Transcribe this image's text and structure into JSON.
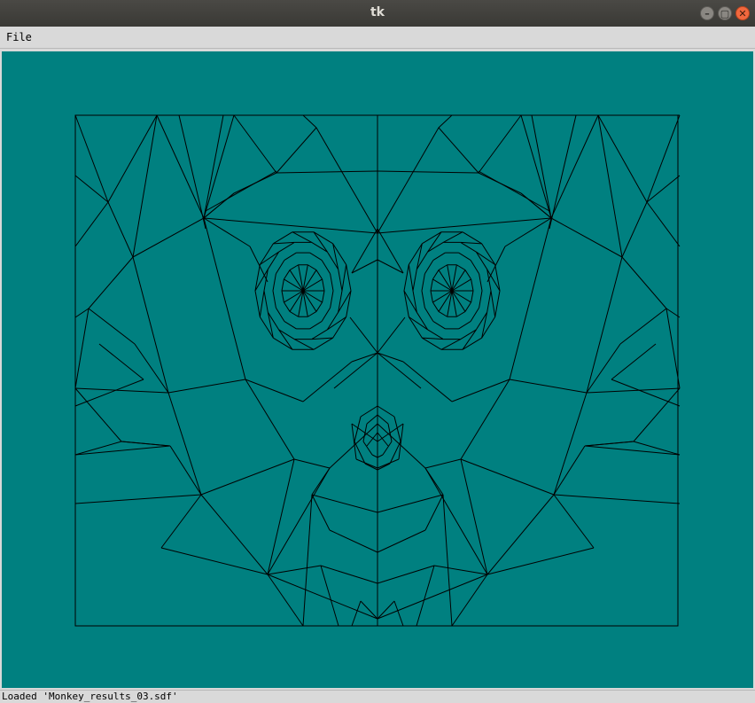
{
  "window": {
    "title": "tk"
  },
  "window_controls": [
    {
      "name": "minimize-button",
      "glyph": "–"
    },
    {
      "name": "maximize-button",
      "glyph": "▢"
    },
    {
      "name": "close-button",
      "glyph": "✕"
    }
  ],
  "menubar": {
    "file_label": "File"
  },
  "canvas": {
    "background": "#008080",
    "line_color": "#000000"
  },
  "status": {
    "text": "Loaded 'Monkey_results_03.sdf'"
  }
}
